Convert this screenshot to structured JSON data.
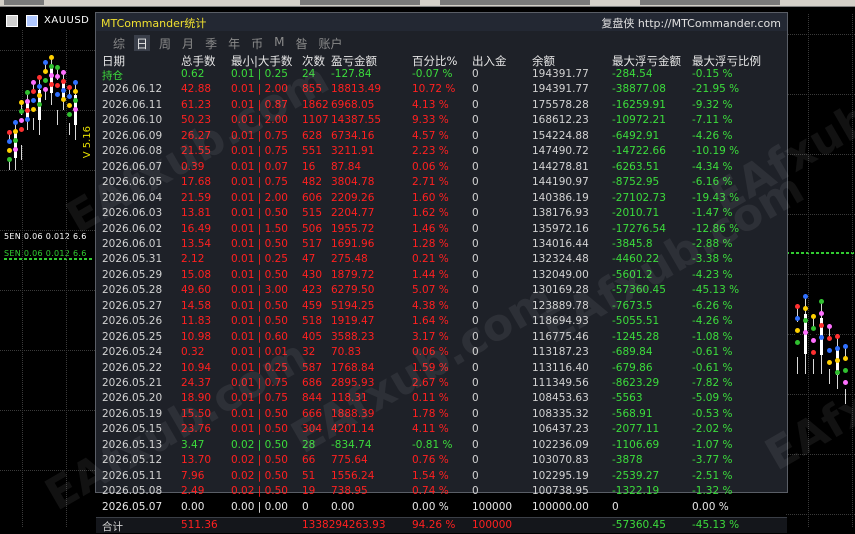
{
  "app": {
    "title": "MTCommander统计",
    "brand": "复盘侠 http://MTCommander.com",
    "symbol": "XAUUSD"
  },
  "chart": {
    "version_label": "V 5.16",
    "note_lines": [
      "5EN 0.06 0.012 6.6",
      "SEN 0.06 0.012 6.6"
    ],
    "watermark": "EAfxub.com"
  },
  "tabs": [
    {
      "label": "综",
      "active": false
    },
    {
      "label": "日",
      "active": true
    },
    {
      "label": "周",
      "active": false
    },
    {
      "label": "月",
      "active": false
    },
    {
      "label": "季",
      "active": false
    },
    {
      "label": "年",
      "active": false
    },
    {
      "label": "币",
      "active": false
    },
    {
      "label": "M",
      "active": false
    },
    {
      "label": "昝",
      "active": false
    },
    {
      "label": "账户",
      "active": false
    }
  ],
  "table": {
    "headers": [
      "日期",
      "总手数",
      "最小|大手数",
      "次数",
      "盈亏金额",
      "百分比%",
      "出入金",
      "余额",
      "最大浮亏金额",
      "最大浮亏比例"
    ],
    "rows": [
      {
        "c": [
          "持仓",
          "0.62",
          "0.01 | 0.25",
          "24",
          "-127.84",
          "-0.07 %",
          "0",
          "194391.77",
          "-284.54",
          "-0.15 %"
        ],
        "t": "green"
      },
      {
        "c": [
          "2026.06.12",
          "42.88",
          "0.01 | 2.00",
          "855",
          "18813.49",
          "10.72 %",
          "0",
          "194391.77",
          "-38877.08",
          "-21.95 %"
        ],
        "t": "red"
      },
      {
        "c": [
          "2026.06.11",
          "61.23",
          "0.01 | 0.87",
          "1862",
          "6968.05",
          "4.13 %",
          "0",
          "175578.28",
          "-16259.91",
          "-9.32 %"
        ],
        "t": "red"
      },
      {
        "c": [
          "2026.06.10",
          "50.23",
          "0.01 | 2.00",
          "1107",
          "14387.55",
          "9.33 %",
          "0",
          "168612.23",
          "-10972.21",
          "-7.11 %"
        ],
        "t": "red"
      },
      {
        "c": [
          "2026.06.09",
          "26.27",
          "0.01 | 0.75",
          "628",
          "6734.16",
          "4.57 %",
          "0",
          "154224.88",
          "-6492.91",
          "-4.26 %"
        ],
        "t": "red"
      },
      {
        "c": [
          "2026.06.08",
          "21.55",
          "0.01 | 0.75",
          "551",
          "3211.91",
          "2.23 %",
          "0",
          "147490.72",
          "-14722.66",
          "-10.19 %"
        ],
        "t": "red"
      },
      {
        "c": [
          "2026.06.07",
          "0.39",
          "0.01 | 0.07",
          "16",
          "87.84",
          "0.06 %",
          "0",
          "144278.81",
          "-6263.51",
          "-4.34 %"
        ],
        "t": "red"
      },
      {
        "c": [
          "2026.06.05",
          "17.68",
          "0.01 | 0.75",
          "482",
          "3804.78",
          "2.71 %",
          "0",
          "144190.97",
          "-8752.95",
          "-6.16 %"
        ],
        "t": "red"
      },
      {
        "c": [
          "2026.06.04",
          "21.59",
          "0.01 | 2.00",
          "606",
          "2209.26",
          "1.60 %",
          "0",
          "140386.19",
          "-27102.73",
          "-19.43 %"
        ],
        "t": "red"
      },
      {
        "c": [
          "2026.06.03",
          "13.81",
          "0.01 | 0.50",
          "515",
          "2204.77",
          "1.62 %",
          "0",
          "138176.93",
          "-2010.71",
          "-1.47 %"
        ],
        "t": "red"
      },
      {
        "c": [
          "2026.06.02",
          "16.49",
          "0.01 | 1.50",
          "506",
          "1955.72",
          "1.46 %",
          "0",
          "135972.16",
          "-17276.54",
          "-12.86 %"
        ],
        "t": "red"
      },
      {
        "c": [
          "2026.06.01",
          "13.54",
          "0.01 | 0.50",
          "517",
          "1691.96",
          "1.28 %",
          "0",
          "134016.44",
          "-3845.8",
          "-2.88 %"
        ],
        "t": "red"
      },
      {
        "c": [
          "2026.05.31",
          "2.12",
          "0.01 | 0.25",
          "47",
          "275.48",
          "0.21 %",
          "0",
          "132324.48",
          "-4460.22",
          "-3.38 %"
        ],
        "t": "red"
      },
      {
        "c": [
          "2026.05.29",
          "15.08",
          "0.01 | 0.50",
          "430",
          "1879.72",
          "1.44 %",
          "0",
          "132049.00",
          "-5601.2",
          "-4.23 %"
        ],
        "t": "red"
      },
      {
        "c": [
          "2026.05.28",
          "49.60",
          "0.01 | 3.00",
          "423",
          "6279.50",
          "5.07 %",
          "0",
          "130169.28",
          "-57360.45",
          "-45.13 %"
        ],
        "t": "red"
      },
      {
        "c": [
          "2026.05.27",
          "14.58",
          "0.01 | 0.50",
          "459",
          "5194.25",
          "4.38 %",
          "0",
          "123889.78",
          "-7673.5",
          "-6.26 %"
        ],
        "t": "red"
      },
      {
        "c": [
          "2026.05.26",
          "11.83",
          "0.01 | 0.50",
          "518",
          "1919.47",
          "1.64 %",
          "0",
          "118694.93",
          "-5055.51",
          "-4.26 %"
        ],
        "t": "red"
      },
      {
        "c": [
          "2026.05.25",
          "10.98",
          "0.01 | 0.60",
          "405",
          "3588.23",
          "3.17 %",
          "0",
          "116775.46",
          "-1245.28",
          "-1.08 %"
        ],
        "t": "red"
      },
      {
        "c": [
          "2026.05.24",
          "0.32",
          "0.01 | 0.01",
          "32",
          "70.83",
          "0.06 %",
          "0",
          "113187.23",
          "-689.84",
          "-0.61 %"
        ],
        "t": "red"
      },
      {
        "c": [
          "2026.05.22",
          "10.94",
          "0.01 | 0.25",
          "587",
          "1768.84",
          "1.59 %",
          "0",
          "113116.40",
          "-679.86",
          "-0.61 %"
        ],
        "t": "red"
      },
      {
        "c": [
          "2026.05.21",
          "24.37",
          "0.01 | 0.75",
          "686",
          "2895.93",
          "2.67 %",
          "0",
          "111349.56",
          "-8623.29",
          "-7.82 %"
        ],
        "t": "red"
      },
      {
        "c": [
          "2026.05.20",
          "18.90",
          "0.01 | 0.75",
          "844",
          "118.31",
          "0.11 %",
          "0",
          "108453.63",
          "-5563",
          "-5.09 %"
        ],
        "t": "red"
      },
      {
        "c": [
          "2026.05.19",
          "15.50",
          "0.01 | 0.50",
          "666",
          "1888.39",
          "1.78 %",
          "0",
          "108335.32",
          "-568.91",
          "-0.53 %"
        ],
        "t": "red"
      },
      {
        "c": [
          "2026.05.15",
          "23.76",
          "0.01 | 0.50",
          "304",
          "4201.14",
          "4.11 %",
          "0",
          "106437.23",
          "-2077.11",
          "-2.02 %"
        ],
        "t": "red"
      },
      {
        "c": [
          "2026.05.13",
          "3.47",
          "0.02 | 0.50",
          "28",
          "-834.74",
          "-0.81 %",
          "0",
          "102236.09",
          "-1106.69",
          "-1.07 %"
        ],
        "t": "green"
      },
      {
        "c": [
          "2026.05.12",
          "13.70",
          "0.02 | 0.50",
          "66",
          "775.64",
          "0.76 %",
          "0",
          "103070.83",
          "-3878",
          "-3.77 %"
        ],
        "t": "red"
      },
      {
        "c": [
          "2026.05.11",
          "7.96",
          "0.02 | 0.50",
          "51",
          "1556.24",
          "1.54 %",
          "0",
          "102295.19",
          "-2539.27",
          "-2.51 %"
        ],
        "t": "red"
      },
      {
        "c": [
          "2026.05.08",
          "2.49",
          "0.02 | 0.50",
          "19",
          "738.95",
          "0.74 %",
          "0",
          "100738.95",
          "-1322.19",
          "-1.32 %"
        ],
        "t": "red"
      },
      {
        "c": [
          "2026.05.07",
          "0.00",
          "0.00 | 0.00",
          "0",
          "0.00",
          "0.00 %",
          "100000",
          "100000.00",
          "0",
          "0.00 %"
        ],
        "t": "white"
      }
    ],
    "total": [
      "合计",
      "511.36",
      "",
      "1338294263.93",
      "",
      "94.26 %",
      "100000",
      "",
      "-57360.45",
      "-45.13 %"
    ]
  }
}
